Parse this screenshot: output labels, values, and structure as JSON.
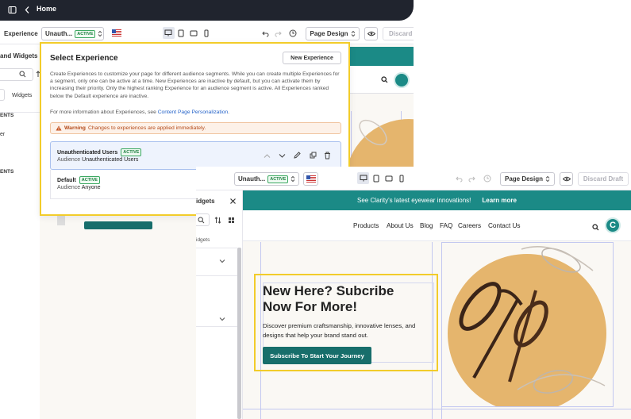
{
  "topbar": {
    "title": "Home"
  },
  "toolbar": {
    "experience_label": "Experience",
    "experience_value": "Unauth...",
    "badge": "ACTIVE",
    "page_design": "Page Design",
    "discard": "Discard"
  },
  "left_panel": {
    "title": "and Widgets",
    "tab_widgets": "Widgets",
    "section1": "ENTS",
    "item1": "er",
    "section2": "ENTS"
  },
  "dropdown": {
    "title": "Select Experience",
    "new_button": "New Experience",
    "description": "Create Experiences to customize your page for different audience segments. While you can create multiple Experiences for a segment, only one can be active at a time. New Experiences are inactive by default, but you can activate them by increasing their priority. Only the highest ranking Experience for an audience segment is active. All Experiences ranked below the Default experience are inactive.",
    "more_prefix": "For more information about Experiences, see ",
    "more_link": "Content Page Personalization",
    "more_suffix": ".",
    "warning_label": "Warning",
    "warning_text": "Changes to experiences are applied immediately.",
    "experiences": [
      {
        "name": "Unauthenticated Users",
        "badge": "ACTIVE",
        "audience_label": "Audience",
        "audience": "Unauthenticated Users"
      },
      {
        "name": "Default",
        "badge": "ACTIVE",
        "audience_label": "Audience",
        "audience": "Anyone"
      }
    ]
  },
  "front": {
    "toolbar": {
      "experience_value": "Unauth...",
      "badge": "ACTIVE",
      "page_design": "Page Design",
      "discard": "Discard Draft"
    },
    "sidebar": {
      "title": "idgets",
      "tab": "idgets"
    },
    "site": {
      "announcement": "See Clarity's latest eyewear innovations!",
      "announcement_link": "Learn more",
      "nav": [
        "Products",
        "About Us",
        "Blog",
        "FAQ",
        "Careers",
        "Contact Us"
      ],
      "logo_letter": "C",
      "hero_title": "New Here? Subcribe Now For More!",
      "hero_desc": "Discover premium craftsmanship, innovative lenses, and designs that help your brand stand out.",
      "hero_button": "Subscribe To Start Your Journey"
    }
  },
  "colors": {
    "accent": "#1b8a86",
    "highlight": "#f2cc2a",
    "hero_circle": "#e5b56d",
    "dark_bar": "#20242e"
  }
}
